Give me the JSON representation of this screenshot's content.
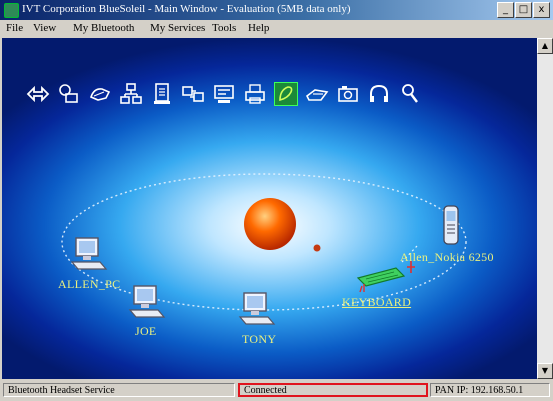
{
  "window": {
    "title": "IVT Corporation BlueSoleil - Main Window - Evaluation (5MB data only)",
    "controls": [
      "_",
      "□",
      "x"
    ]
  },
  "menu": [
    "File",
    "View",
    "My Bluetooth",
    "My Services",
    "Tools",
    "Help"
  ],
  "toolbar_icons": [
    "network-access-icon",
    "fax-icon",
    "dialup-icon",
    "lan-access-icon",
    "file-transfer-icon",
    "sync-icon",
    "serial-port-icon",
    "printer-icon",
    "hid-icon",
    "fax-service-icon",
    "basic-imaging-icon",
    "headset-icon",
    "audio-gateway-icon"
  ],
  "devices": [
    {
      "label": "ALLEN_PC",
      "type": "desktop-computer"
    },
    {
      "label": "JOE",
      "type": "desktop-computer"
    },
    {
      "label": "TONY",
      "type": "desktop-computer"
    },
    {
      "label": "KEYBOARD",
      "type": "keyboard"
    },
    {
      "label": "Allen_Nokia 6250",
      "type": "mobile-phone"
    }
  ],
  "status": {
    "left": "Bluetooth Headset Service",
    "center": "Connected",
    "right": "PAN IP: 192.168.50.1"
  },
  "colors": {
    "title_gradient_start": "#0a246a",
    "device_label": "#e8f080",
    "highlight_box": "#e0141e",
    "sun": "#ff6a00"
  }
}
